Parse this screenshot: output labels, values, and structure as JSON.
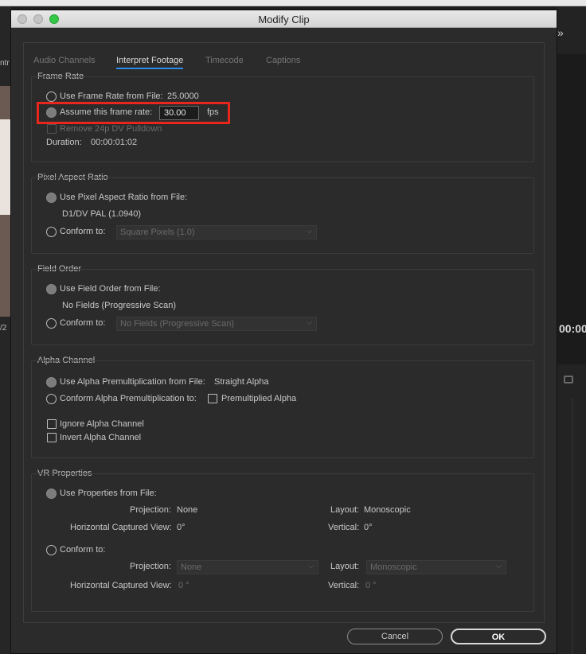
{
  "background": {
    "left_texts": [
      "ntr",
      "/2"
    ],
    "right_timecode": "00:00",
    "right_chevron": "»"
  },
  "dialog": {
    "title": "Modify Clip",
    "tabs": [
      "Audio Channels",
      "Interpret Footage",
      "Timecode",
      "Captions"
    ],
    "active_tab": "Interpret Footage"
  },
  "frame_rate": {
    "title": "Frame Rate",
    "use_from_file_label": "Use Frame Rate from File:",
    "use_from_file_value": "25.0000",
    "assume_label": "Assume this frame rate:",
    "assume_value": "30.00",
    "fps_unit": "fps",
    "pulldown_label": "Remove 24p DV Pulldown",
    "duration_label": "Duration:",
    "duration_value": "00:00:01:02"
  },
  "pixel_aspect": {
    "title": "Pixel Aspect Ratio",
    "use_from_file_label": "Use Pixel Aspect Ratio from File:",
    "file_value": "D1/DV PAL (1.0940)",
    "conform_label": "Conform to:",
    "conform_value": "Square Pixels (1.0)"
  },
  "field_order": {
    "title": "Field Order",
    "use_from_file_label": "Use Field Order from File:",
    "file_value": "No Fields (Progressive Scan)",
    "conform_label": "Conform to:",
    "conform_value": "No Fields (Progressive Scan)"
  },
  "alpha": {
    "title": "Alpha Channel",
    "use_from_file_label": "Use Alpha Premultiplication from File:",
    "file_value": "Straight Alpha",
    "conform_label": "Conform Alpha Premultiplication to:",
    "premultiplied_label": "Premultiplied Alpha",
    "ignore_label": "Ignore Alpha Channel",
    "invert_label": "Invert Alpha Channel"
  },
  "vr": {
    "title": "VR Properties",
    "use_from_file_label": "Use Properties from File:",
    "projection_label": "Projection:",
    "projection_value": "None",
    "layout_label": "Layout:",
    "layout_value": "Monoscopic",
    "hcv_label": "Horizontal Captured View:",
    "hcv_value": "0°",
    "vertical_label": "Vertical:",
    "vertical_value": "0°",
    "conform_label": "Conform to:",
    "conform_projection_value": "None",
    "conform_layout_value": "Monoscopic",
    "conform_hcv_value": "0 °",
    "conform_vertical_value": "0 °"
  },
  "buttons": {
    "cancel": "Cancel",
    "ok": "OK"
  },
  "colors": {
    "highlight": "#e8261c",
    "tab_underline": "#2d8ceb",
    "dialog_bg": "#2b2b2b"
  }
}
